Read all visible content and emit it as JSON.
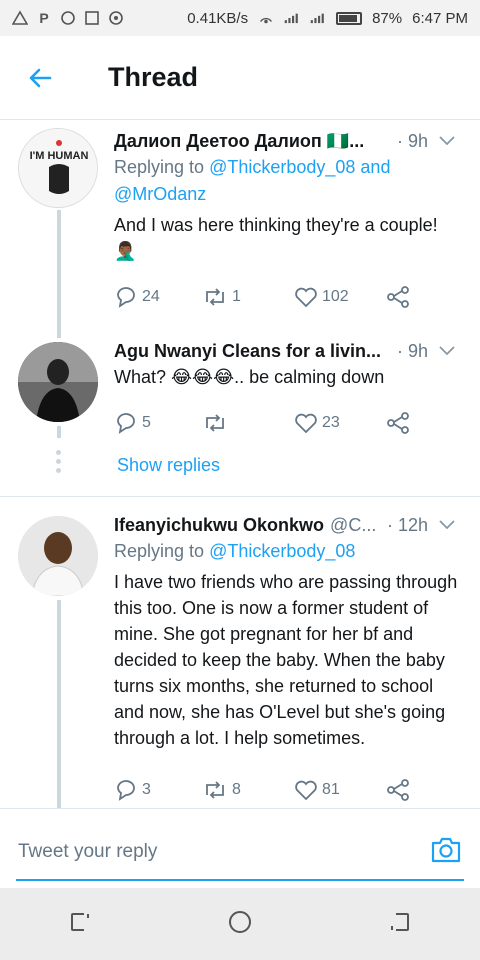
{
  "status_bar": {
    "speed": "0.41KB/s",
    "battery": "87%",
    "time": "6:47 PM"
  },
  "header": {
    "title": "Thread"
  },
  "tweets": [
    {
      "name": "Далиоп Деетоо Далиоп 🇳🇬...",
      "time": "· 9h",
      "replying_prefix": "Replying to",
      "replying_to": "@Thickerbody_08 and",
      "replying_to_2": "@MrOdanz",
      "body": "And I was here thinking they're a couple! 🤦🏾‍♂️",
      "replies": "24",
      "retweets": "1",
      "likes": "102",
      "avatar_text": "I'M HUMAN"
    },
    {
      "name": "Agu Nwanyi Cleans for a livin...",
      "time": "· 9h",
      "body": "What? 😂😂😂.. be calming down",
      "replies": "5",
      "retweets": "",
      "likes": "23"
    },
    {
      "name": "Ifeanyichukwu Okonkwo",
      "handle": "@C...",
      "time": "· 12h",
      "replying_prefix": "Replying to",
      "replying_to": "@Thickerbody_08",
      "body": "I have two friends who are passing through this too. One is now a former student of mine. She got pregnant for her bf and decided to keep the baby. When the baby turns six months, she returned to school and now, she has O'Level but she's going through a lot. I help sometimes.",
      "replies": "3",
      "retweets": "8",
      "likes": "81"
    }
  ],
  "show_replies": "Show replies",
  "reply_bar": {
    "placeholder": "Tweet your reply"
  },
  "colors": {
    "accent": "#1da1f2",
    "muted": "#657786",
    "text": "#14171a"
  }
}
